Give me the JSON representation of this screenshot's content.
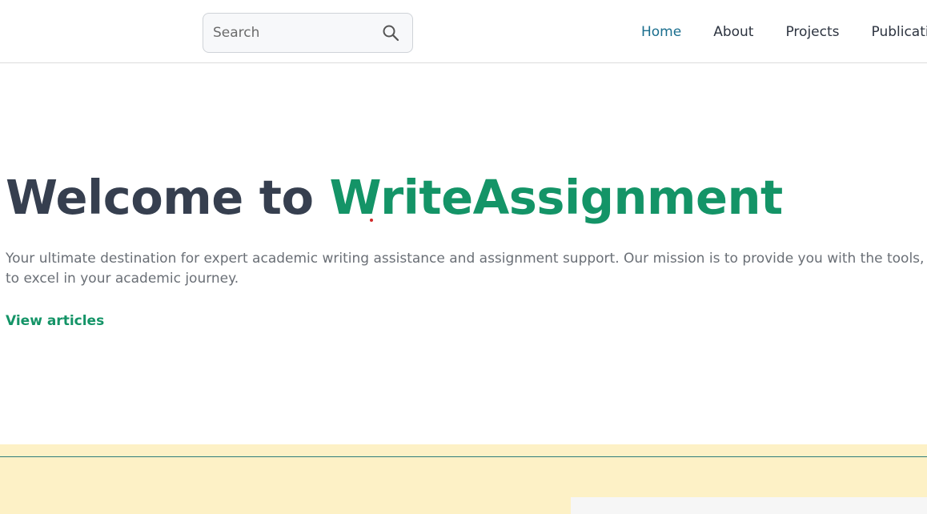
{
  "search": {
    "placeholder": "Search"
  },
  "nav": {
    "items": [
      {
        "label": "Home",
        "active": true
      },
      {
        "label": "About",
        "active": false
      },
      {
        "label": "Projects",
        "active": false
      },
      {
        "label": "Publications",
        "active": false
      }
    ]
  },
  "hero": {
    "title_prefix": "Welcome to ",
    "title_brand": "WriteAssignment",
    "description_line1": "Your ultimate destination for expert academic writing assistance and assignment support. Our mission is to provide you with the tools, resources",
    "description_line2": "to excel in your academic journey.",
    "cta_label": "View articles"
  },
  "colors": {
    "brand_green": "#149467",
    "nav_active": "#1a6e8e",
    "heading_dark": "#363f4f",
    "band_background": "#fdf1c6",
    "band_line": "#2e7d7a"
  },
  "icons": {
    "search": "search-icon"
  }
}
